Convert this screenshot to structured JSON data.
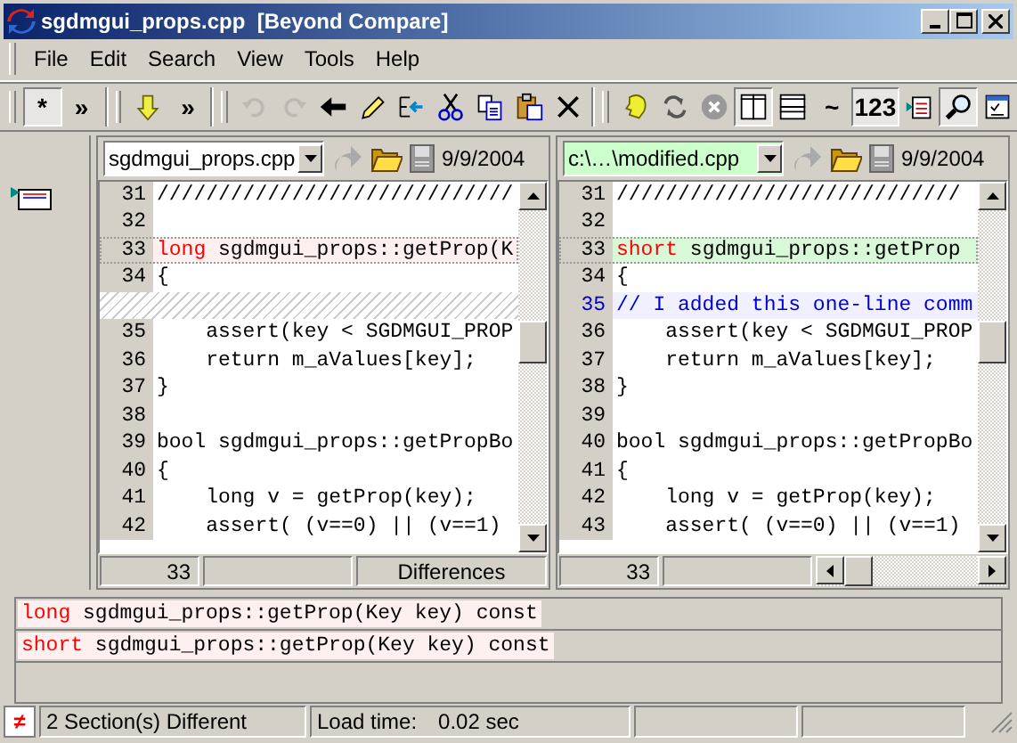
{
  "window": {
    "title": "sgdmgui_props.cpp  [Beyond Compare]"
  },
  "menu": [
    "File",
    "Edit",
    "Search",
    "View",
    "Tools",
    "Help"
  ],
  "toolbar": [
    {
      "kind": "text",
      "label": "*",
      "pressed": true
    },
    {
      "kind": "text",
      "label": "»",
      "pressed": false
    },
    {
      "kind": "sep"
    },
    {
      "kind": "icon",
      "pressed": false,
      "disabled": false
    },
    {
      "kind": "text",
      "label": "»",
      "pressed": false
    },
    {
      "kind": "sep"
    },
    {
      "kind": "icon",
      "pressed": false,
      "disabled": true
    },
    {
      "kind": "icon",
      "pressed": false,
      "disabled": true
    },
    {
      "kind": "icon",
      "pressed": false,
      "disabled": false
    },
    {
      "kind": "icon",
      "pressed": false,
      "disabled": false
    },
    {
      "kind": "icon",
      "pressed": false,
      "disabled": false
    },
    {
      "kind": "icon",
      "pressed": false,
      "disabled": false
    },
    {
      "kind": "icon",
      "pressed": false,
      "disabled": false
    },
    {
      "kind": "icon",
      "pressed": false,
      "disabled": false
    },
    {
      "kind": "icon",
      "pressed": false,
      "disabled": false
    },
    {
      "kind": "sep"
    },
    {
      "kind": "icon",
      "pressed": false,
      "disabled": false
    },
    {
      "kind": "icon",
      "pressed": false,
      "disabled": false
    },
    {
      "kind": "icon",
      "pressed": false,
      "disabled": false
    },
    {
      "kind": "icon",
      "pressed": true,
      "disabled": false
    },
    {
      "kind": "icon",
      "pressed": false,
      "disabled": false
    },
    {
      "kind": "text",
      "label": "~",
      "pressed": false
    },
    {
      "kind": "text",
      "label": "123",
      "pressed": true
    },
    {
      "kind": "icon",
      "pressed": false,
      "disabled": false
    },
    {
      "kind": "icon",
      "pressed": true,
      "disabled": false
    },
    {
      "kind": "icon",
      "pressed": false,
      "disabled": false
    }
  ],
  "panes": [
    {
      "file": "sgdmgui_props.cpp",
      "date": "9/9/2004",
      "highlighted": false,
      "lines": [
        {
          "kind": "normal",
          "number": "31",
          "text": "/////////////////////////////"
        },
        {
          "kind": "normal",
          "number": "32"
        },
        {
          "kind": "changed",
          "number": "33",
          "changed_text": "long",
          "text": " sgdmgui_props::getProp(K"
        },
        {
          "kind": "normal",
          "number": "34",
          "text": "{"
        },
        {
          "kind": "gap"
        },
        {
          "kind": "normal",
          "number": "35",
          "text": "    assert(key < SGDMGUI_PROP"
        },
        {
          "kind": "normal",
          "number": "36",
          "text": "    return m_aValues[key];"
        },
        {
          "kind": "normal",
          "number": "37",
          "text": "}"
        },
        {
          "kind": "normal",
          "number": "38"
        },
        {
          "kind": "normal",
          "number": "39",
          "text": "bool sgdmgui_props::getPropBo"
        },
        {
          "kind": "normal",
          "number": "40",
          "text": "{"
        },
        {
          "kind": "normal",
          "number": "41",
          "text": "    long v = getProp(key);"
        },
        {
          "kind": "normal",
          "number": "42",
          "text": "    assert( (v==0) || (v==1)"
        }
      ],
      "footer": {
        "kind": "mode",
        "line": "33",
        "mode": "Differences"
      }
    },
    {
      "file": "c:\\…\\modified.cpp",
      "date": "9/9/2004",
      "highlighted": true,
      "lines": [
        {
          "kind": "normal",
          "number": "31",
          "text": "////////////////////////////"
        },
        {
          "kind": "normal",
          "number": "32"
        },
        {
          "kind": "changed",
          "number": "33",
          "changed_text": "short",
          "text": " sgdmgui_props::getProp"
        },
        {
          "kind": "normal",
          "number": "34",
          "text": "{"
        },
        {
          "kind": "added",
          "number": "35",
          "text": "// I added this one-line comm"
        },
        {
          "kind": "normal",
          "number": "36",
          "text": "    assert(key < SGDMGUI_PROP"
        },
        {
          "kind": "normal",
          "number": "37",
          "text": "    return m_aValues[key];"
        },
        {
          "kind": "normal",
          "number": "38",
          "text": "}"
        },
        {
          "kind": "normal",
          "number": "39"
        },
        {
          "kind": "normal",
          "number": "40",
          "text": "bool sgdmgui_props::getPropBo"
        },
        {
          "kind": "normal",
          "number": "41",
          "text": "{"
        },
        {
          "kind": "normal",
          "number": "42",
          "text": "    long v = getProp(key);"
        },
        {
          "kind": "normal",
          "number": "43",
          "text": "    assert( (v==0) || (v==1)"
        }
      ],
      "footer": {
        "kind": "scroll",
        "line": "33"
      }
    }
  ],
  "detail": [
    {
      "changed_text": "long",
      "text": " sgdmgui_props::getProp(Key key) const"
    },
    {
      "changed_text": "short",
      "text": " sgdmgui_props::getProp(Key key) const"
    }
  ],
  "status_bar": {
    "icon": "≠",
    "sections": "2 Section(s) Different",
    "load_label": "Load time:",
    "load_value": "0.02 sec"
  }
}
